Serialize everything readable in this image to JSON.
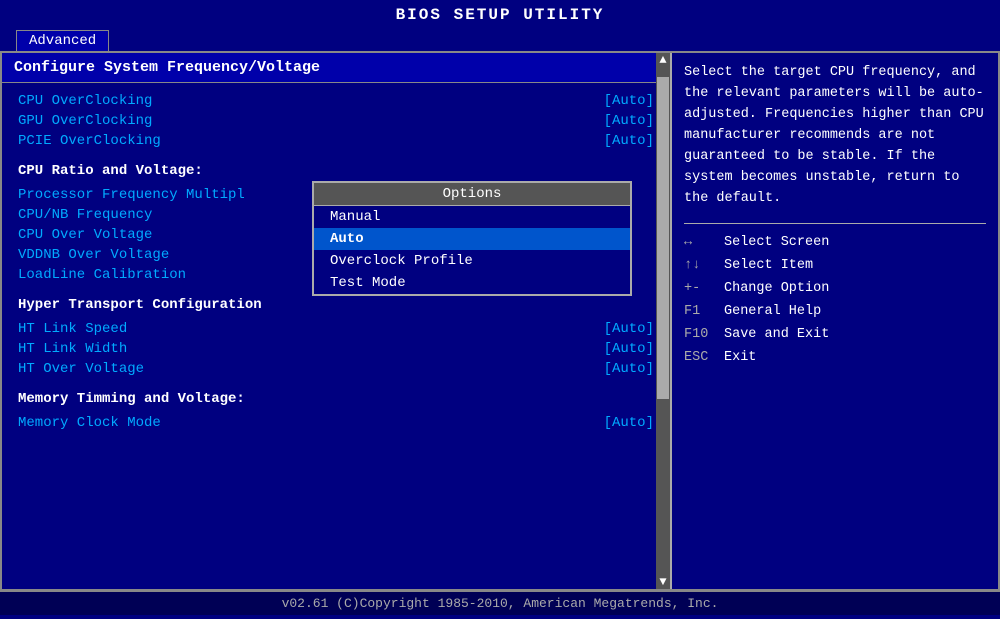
{
  "title": "BIOS SETUP UTILITY",
  "tabs": [
    {
      "label": "Advanced",
      "active": true
    }
  ],
  "left_panel": {
    "section_header": "Configure System Frequency/Voltage",
    "settings_group1": [
      {
        "label": "CPU OverClocking",
        "value": "[Auto]"
      },
      {
        "label": "GPU OverClocking",
        "value": "[Auto]"
      },
      {
        "label": "PCIE OverClocking",
        "value": "[Auto]"
      }
    ],
    "section2_title": "CPU Ratio and Voltage:",
    "settings_group2": [
      {
        "label": "Processor Frequency Multipl",
        "value": ""
      },
      {
        "label": "CPU/NB Frequency",
        "value": ""
      },
      {
        "label": "CPU Over Voltage",
        "value": ""
      },
      {
        "label": "VDDNB Over Voltage",
        "value": ""
      },
      {
        "label": "LoadLine Calibration",
        "value": ""
      }
    ],
    "section3_title": "Hyper Transport Configuration",
    "settings_group3": [
      {
        "label": "HT Link Speed",
        "value": "[Auto]"
      },
      {
        "label": "HT Link Width",
        "value": "[Auto]"
      },
      {
        "label": "HT Over Voltage",
        "value": "[Auto]"
      }
    ],
    "section4_title": "Memory Timming and Voltage:",
    "settings_group4": [
      {
        "label": "Memory Clock Mode",
        "value": "[Auto]"
      }
    ]
  },
  "dropdown": {
    "title": "Options",
    "items": [
      {
        "label": "Manual",
        "selected": false
      },
      {
        "label": "Auto",
        "selected": true
      },
      {
        "label": "Overclock Profile",
        "selected": false
      },
      {
        "label": "Test Mode",
        "selected": false
      }
    ]
  },
  "right_panel": {
    "help_text": "Select the target CPU frequency, and the relevant parameters will be auto-adjusted. Frequencies higher than CPU manufacturer recommends are not guaranteed to be stable. If the system becomes unstable, return to the default.",
    "keys": [
      {
        "key": "↔",
        "desc": "Select Screen"
      },
      {
        "key": "↑↓",
        "desc": "Select Item"
      },
      {
        "key": "+-",
        "desc": "Change Option"
      },
      {
        "key": "F1",
        "desc": "General Help"
      },
      {
        "key": "F10",
        "desc": "Save and Exit"
      },
      {
        "key": "ESC",
        "desc": "Exit"
      }
    ]
  },
  "footer": "v02.61  (C)Copyright 1985-2010, American Megatrends, Inc."
}
